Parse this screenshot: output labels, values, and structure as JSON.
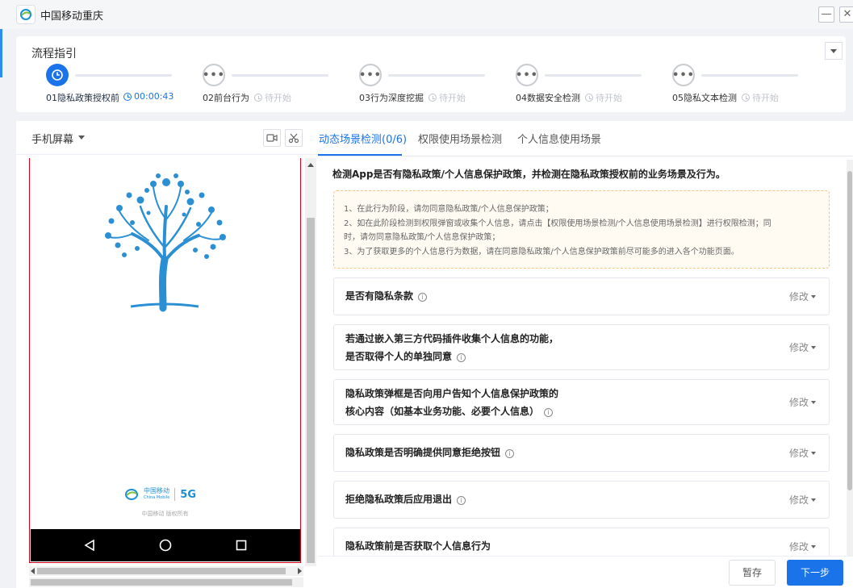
{
  "window": {
    "title": "中国移动重庆",
    "minimize_label": "—",
    "close_label": "✕"
  },
  "guide": {
    "title": "流程指引",
    "steps": [
      {
        "label": "01隐私政策授权前",
        "status": "00:00:43",
        "state": "active"
      },
      {
        "label": "02前台行为",
        "status": "待开始",
        "state": "pending"
      },
      {
        "label": "03行为深度挖掘",
        "status": "待开始",
        "state": "pending"
      },
      {
        "label": "04数据安全检测",
        "status": "待开始",
        "state": "pending"
      },
      {
        "label": "05隐私文本检测",
        "status": "待开始",
        "state": "pending"
      }
    ],
    "pending_glyph": "•••"
  },
  "phone": {
    "title": "手机屏幕",
    "brand_name": "中国移动",
    "brand_sub": "China Mobile",
    "brand_5g": "5G",
    "copyright": "中国移动  版权所有"
  },
  "tabs": [
    {
      "label": "动态场景检测(0/6)",
      "active": true
    },
    {
      "label": "权限使用场景检测",
      "active": false
    },
    {
      "label": "个人信息使用场景",
      "active": false
    }
  ],
  "content": {
    "title": "检测App是否有隐私政策/个人信息保护政策，并检测在隐私政策授权前的业务场景及行为。",
    "notice": [
      "1、在此行为阶段，请勿同意隐私政策/个人信息保护政策；",
      "2、如在此阶段检测到权限弹窗或收集个人信息，请点击【权限使用场景检测/个人信息使用场景检测】进行权限检测；同",
      "时，请勿同意隐私政策/个人信息保护政策；",
      "3、为了获取更多的个人信息行为数据，请在同意隐私政策/个人信息保护政策前尽可能多的进入各个功能页面。"
    ],
    "questions": [
      {
        "line1": "是否有隐私条款",
        "line2": ""
      },
      {
        "line1": "若通过嵌入第三方代码插件收集个人信息的功能，",
        "line2": "是否取得个人的单独同意"
      },
      {
        "line1": "隐私政策弹框是否向用户告知个人信息保护政策的",
        "line2": "核心内容（如基本业务功能、必要个人信息）"
      },
      {
        "line1": "隐私政策是否明确提供同意拒绝按钮",
        "line2": ""
      },
      {
        "line1": "拒绝隐私政策后应用退出",
        "line2": ""
      },
      {
        "line1": "隐私政策前是否获取个人信息行为",
        "line2": ""
      }
    ],
    "edit_label": "修改",
    "info_glyph": "i"
  },
  "footer": {
    "pause_label": "暂存",
    "next_label": "下一步"
  },
  "colors": {
    "accent": "#1a73e8",
    "notice_bg": "#fffbf2",
    "tree_blue": "#2b8fd4"
  }
}
